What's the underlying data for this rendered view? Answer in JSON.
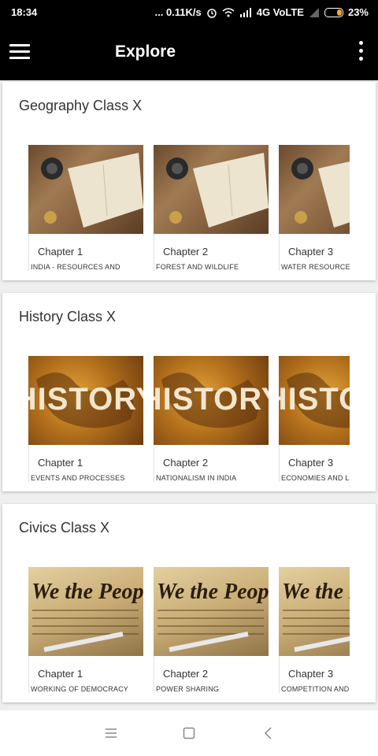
{
  "status_bar": {
    "time": "18:34",
    "network_speed": "... 0.11K/s",
    "network": "4G VoLTE",
    "battery": "23%"
  },
  "app_bar": {
    "title": "Explore",
    "menu_icon": "hamburger-menu-icon",
    "more_icon": "more-vert-icon"
  },
  "sections": [
    {
      "title": "Geography Class X",
      "image": "map-camera-image",
      "chapters": [
        {
          "chapter": "Chapter 1",
          "subtitle": "INDIA - RESOURCES AND"
        },
        {
          "chapter": "Chapter 2",
          "subtitle": "FOREST AND  WILDLIFE"
        },
        {
          "chapter": "Chapter 3",
          "subtitle": "WATER RESOURCE"
        }
      ]
    },
    {
      "title": "History Class X",
      "image": "history-world-map-image",
      "image_text": "HISTORY",
      "chapters": [
        {
          "chapter": "Chapter 1",
          "subtitle": "EVENTS AND PROCESSES"
        },
        {
          "chapter": "Chapter 2",
          "subtitle": "NATIONALISM IN INDIA"
        },
        {
          "chapter": "Chapter 3",
          "subtitle": "ECONOMIES AND L"
        }
      ]
    },
    {
      "title": "Civics Class X",
      "image": "we-the-people-constitution-image",
      "image_text": "We the People",
      "chapters": [
        {
          "chapter": "Chapter 1",
          "subtitle": "WORKING OF DEMOCRACY"
        },
        {
          "chapter": "Chapter 2",
          "subtitle": "POWER SHARING"
        },
        {
          "chapter": "Chapter 3",
          "subtitle": "COMPETITION AND"
        }
      ]
    }
  ],
  "nav_bar": {
    "menu_icon": "recent-apps-icon",
    "home_icon": "home-icon",
    "back_icon": "back-icon"
  }
}
